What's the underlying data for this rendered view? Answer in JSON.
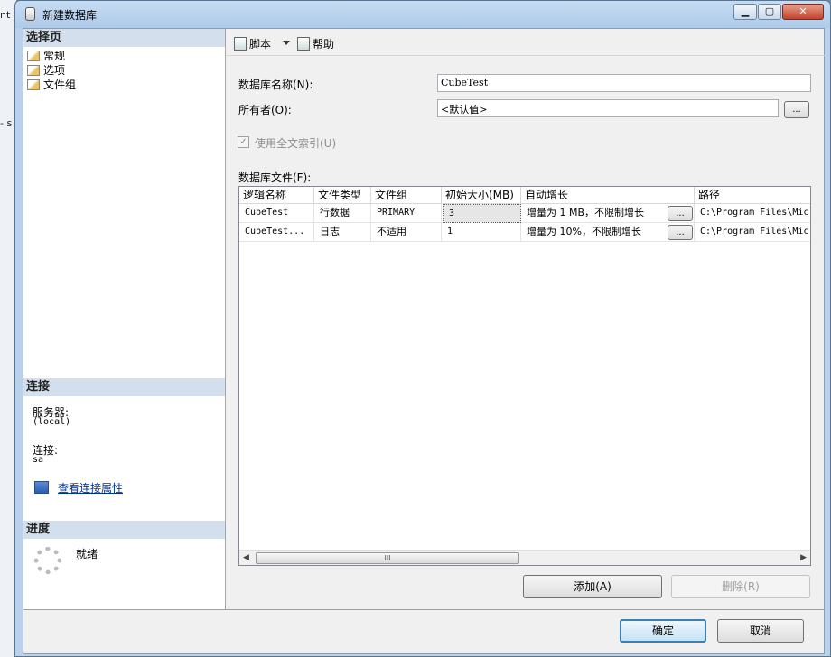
{
  "background": {
    "fragments": [
      "nt S",
      "- s"
    ]
  },
  "window": {
    "title": "新建数据库",
    "controls": {
      "minimize": "▁",
      "maximize": "▢",
      "close": "✕"
    }
  },
  "left_pane": {
    "select_page_header": "选择页",
    "pages": [
      {
        "label": "常规",
        "icon": "page-settings-icon"
      },
      {
        "label": "选项",
        "icon": "page-settings-icon"
      },
      {
        "label": "文件组",
        "icon": "page-settings-icon"
      }
    ],
    "connection_header": "连接",
    "server_label": "服务器:",
    "server_value": "(local)",
    "connection_label": "连接:",
    "connection_value": "sa",
    "view_properties_link": "查看连接属性",
    "progress_header": "进度",
    "progress_status": "就绪"
  },
  "toolbar": {
    "script_label": "脚本",
    "help_label": "帮助"
  },
  "form": {
    "db_name_label": "数据库名称(N):",
    "db_name_value": "CubeTest",
    "owner_label": "所有者(O):",
    "owner_value": "<默认值>",
    "owner_browse": "...",
    "fulltext_label": "使用全文索引(U)",
    "fulltext_checked": true,
    "files_label": "数据库文件(F):"
  },
  "files_grid": {
    "columns": [
      "逻辑名称",
      "文件类型",
      "文件组",
      "初始大小(MB)",
      "自动增长",
      "路径"
    ],
    "rows": [
      {
        "name": "CubeTest",
        "type": "行数据",
        "filegroup": "PRIMARY",
        "size": "3",
        "growth": "增量为 1 MB，不限制增长",
        "growth_btn": "...",
        "path": "C:\\Program Files\\Mic"
      },
      {
        "name": "CubeTest...",
        "type": "日志",
        "filegroup": "不适用",
        "size": "1",
        "growth": "增量为 10%，不限制增长",
        "growth_btn": "...",
        "path": "C:\\Program Files\\Mic"
      }
    ],
    "scroll": {
      "left": "◀",
      "right": "▶",
      "grip": "III"
    }
  },
  "buttons": {
    "add": "添加(A)",
    "remove": "删除(R)",
    "ok": "确定",
    "cancel": "取消"
  }
}
